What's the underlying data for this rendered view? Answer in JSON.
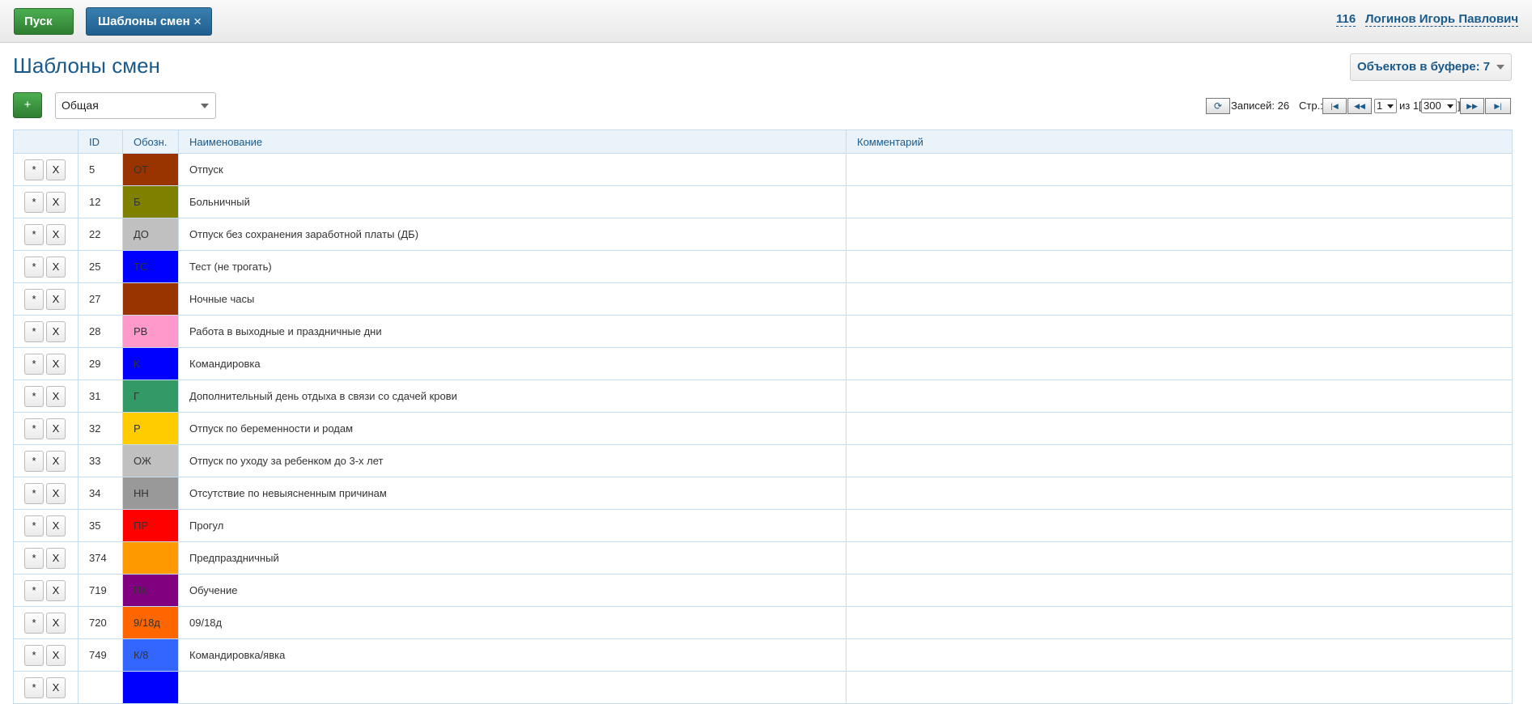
{
  "header": {
    "start_label": "Пуск",
    "active_tab_label": "Шаблоны смен",
    "user_id": "116",
    "user_name": "Логинов Игорь Павлович"
  },
  "page": {
    "title": "Шаблоны смен",
    "buffer_label": "Объектов в буфере: 7",
    "add_label": "+",
    "group_value": "Общая"
  },
  "pager": {
    "records_label": "Записей: 26",
    "page_label": "Стр.:",
    "page_value": "1",
    "of_label": "из 1",
    "page_size": "300",
    "bracket_open": "[",
    "bracket_close": "]"
  },
  "table": {
    "columns": [
      "",
      "ID",
      "Обозн.",
      "Наименование",
      "Комментарий"
    ],
    "edit_label": "*",
    "delete_label": "X",
    "rows": [
      {
        "id": "5",
        "code": "ОТ",
        "color": "#993300",
        "name": "Отпуск",
        "comment": ""
      },
      {
        "id": "12",
        "code": "Б",
        "color": "#808000",
        "name": "Больничный",
        "comment": ""
      },
      {
        "id": "22",
        "code": "ДО",
        "color": "#c0c0c0",
        "name": "Отпуск без сохранения заработной платы (ДБ)",
        "comment": ""
      },
      {
        "id": "25",
        "code": "ТС",
        "color": "#0000ff",
        "name": "Тест (не трогать)",
        "comment": ""
      },
      {
        "id": "27",
        "code": "",
        "color": "#993300",
        "name": "Ночные часы",
        "comment": ""
      },
      {
        "id": "28",
        "code": "РВ",
        "color": "#ff99cc",
        "name": "Работа в выходные и праздничные дни",
        "comment": ""
      },
      {
        "id": "29",
        "code": "К",
        "color": "#0000ff",
        "name": "Командировка",
        "comment": ""
      },
      {
        "id": "31",
        "code": "Г",
        "color": "#339966",
        "name": "Дополнительный день отдыха в связи со сдачей крови",
        "comment": ""
      },
      {
        "id": "32",
        "code": "Р",
        "color": "#ffcc00",
        "name": "Отпуск по беременности и родам",
        "comment": ""
      },
      {
        "id": "33",
        "code": "ОЖ",
        "color": "#c0c0c0",
        "name": "Отпуск по уходу за ребенком до 3-х лет",
        "comment": ""
      },
      {
        "id": "34",
        "code": "НН",
        "color": "#999999",
        "name": "Отсутствие по невыясненным причинам",
        "comment": ""
      },
      {
        "id": "35",
        "code": "ПР",
        "color": "#ff0000",
        "name": "Прогул",
        "comment": ""
      },
      {
        "id": "374",
        "code": "",
        "color": "#ff9900",
        "name": "Предпраздничный",
        "comment": ""
      },
      {
        "id": "719",
        "code": "ПК",
        "color": "#800080",
        "name": "Обучение",
        "comment": ""
      },
      {
        "id": "720",
        "code": "9/18д",
        "color": "#ff6600",
        "name": "09/18д",
        "comment": ""
      },
      {
        "id": "749",
        "code": "К/8",
        "color": "#3366ff",
        "name": "Командировка/явка",
        "comment": ""
      },
      {
        "id": "",
        "code": "",
        "color": "#0000ff",
        "name": "",
        "comment": ""
      }
    ]
  }
}
